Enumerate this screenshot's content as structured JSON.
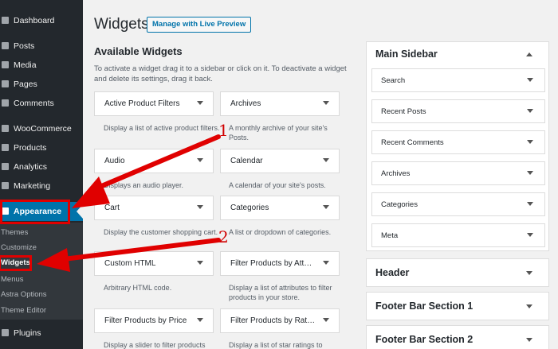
{
  "sidebar": {
    "items": [
      {
        "label": "Dashboard"
      },
      {
        "label": "Posts"
      },
      {
        "label": "Media"
      },
      {
        "label": "Pages"
      },
      {
        "label": "Comments"
      },
      {
        "label": "WooCommerce"
      },
      {
        "label": "Products"
      },
      {
        "label": "Analytics"
      },
      {
        "label": "Marketing"
      },
      {
        "label": "Appearance"
      },
      {
        "label": "Plugins"
      }
    ],
    "submenu": [
      {
        "label": "Themes"
      },
      {
        "label": "Customize"
      },
      {
        "label": "Widgets"
      },
      {
        "label": "Menus"
      },
      {
        "label": "Astra Options"
      },
      {
        "label": "Theme Editor"
      }
    ]
  },
  "header": {
    "title": "Widgets",
    "live_preview": "Manage with Live Preview"
  },
  "available": {
    "title": "Available Widgets",
    "description": "To activate a widget drag it to a sidebar or click on it. To deactivate a widget and delete its settings, drag it back.",
    "widgets": [
      {
        "name": "Active Product Filters",
        "desc": "Display a list of active product filters."
      },
      {
        "name": "Archives",
        "desc": "A monthly archive of your site's Posts."
      },
      {
        "name": "Audio",
        "desc": "Displays an audio player."
      },
      {
        "name": "Calendar",
        "desc": "A calendar of your site's posts."
      },
      {
        "name": "Cart",
        "desc": "Display the customer shopping cart."
      },
      {
        "name": "Categories",
        "desc": "A list or dropdown of categories."
      },
      {
        "name": "Custom HTML",
        "desc": "Arbitrary HTML code."
      },
      {
        "name": "Filter Products by Att…",
        "desc": "Display a list of attributes to filter products in your store."
      },
      {
        "name": "Filter Products by Price",
        "desc": "Display a slider to filter products"
      },
      {
        "name": "Filter Products by Rat…",
        "desc": "Display a list of star ratings to"
      }
    ]
  },
  "main_sidebar": {
    "title": "Main Sidebar",
    "widgets": [
      {
        "name": "Search"
      },
      {
        "name": "Recent Posts"
      },
      {
        "name": "Recent Comments"
      },
      {
        "name": "Archives"
      },
      {
        "name": "Categories"
      },
      {
        "name": "Meta"
      }
    ]
  },
  "other_areas": [
    {
      "title": "Header"
    },
    {
      "title": "Footer Bar Section 1"
    },
    {
      "title": "Footer Bar Section 2"
    }
  ],
  "annotations": [
    "1",
    "2"
  ],
  "colors": {
    "admin_bar": "#23282d",
    "accent": "#0073aa",
    "annotation": "#e00000"
  }
}
